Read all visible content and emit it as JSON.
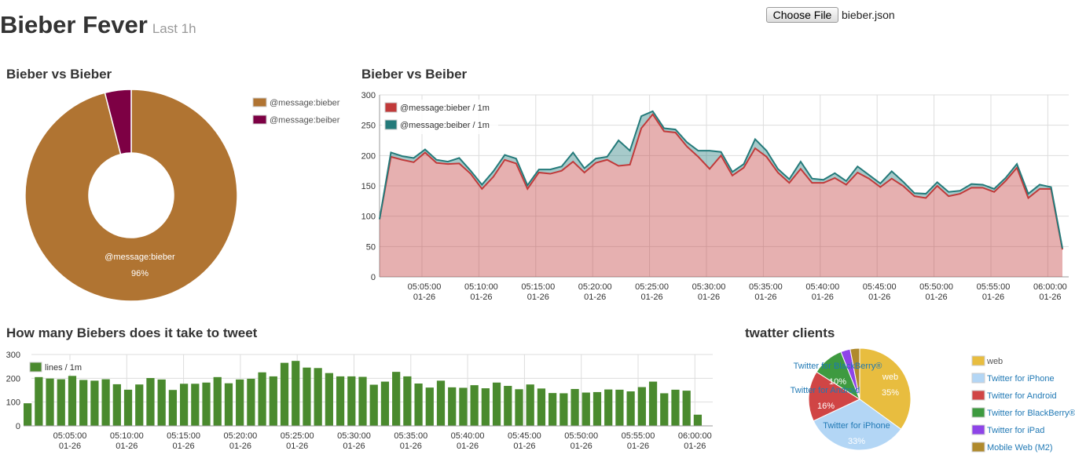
{
  "header": {
    "title": "Bieber Fever",
    "subtitle": "Last 1h"
  },
  "file_input": {
    "button_label": "Choose File",
    "file_name": "bieber.json"
  },
  "panels": {
    "donut_title": "Bieber vs Bieber",
    "area_title": "Bieber vs Beiber",
    "bar_title": "How many Biebers does it take to tweet",
    "clients_title": "twatter clients"
  },
  "x_ticks": [
    {
      "time": "05:05:00",
      "date": "01-26"
    },
    {
      "time": "05:10:00",
      "date": "01-26"
    },
    {
      "time": "05:15:00",
      "date": "01-26"
    },
    {
      "time": "05:20:00",
      "date": "01-26"
    },
    {
      "time": "05:25:00",
      "date": "01-26"
    },
    {
      "time": "05:30:00",
      "date": "01-26"
    },
    {
      "time": "05:35:00",
      "date": "01-26"
    },
    {
      "time": "05:40:00",
      "date": "01-26"
    },
    {
      "time": "05:45:00",
      "date": "01-26"
    },
    {
      "time": "05:50:00",
      "date": "01-26"
    },
    {
      "time": "05:55:00",
      "date": "01-26"
    },
    {
      "time": "06:00:00",
      "date": "01-26"
    }
  ],
  "chart_data": [
    {
      "type": "pie",
      "title": "Bieber vs Bieber",
      "labels": [
        "@message:bieber",
        "@message:beiber"
      ],
      "values": [
        96,
        4
      ],
      "colors": [
        "#b07432",
        "#7d0044"
      ],
      "slice_label": "@message:bieber",
      "slice_percent": "96%",
      "legend_position": "top-right"
    },
    {
      "type": "area",
      "title": "Bieber vs Beiber",
      "ylim": [
        0,
        300
      ],
      "yticks": [
        0,
        50,
        100,
        150,
        200,
        250,
        300
      ],
      "grid": true,
      "legend_position": "top-left",
      "series": [
        {
          "name": "@message:bieber / 1m",
          "color": "#c13a3a",
          "values": [
            95,
            198,
            193,
            189,
            205,
            188,
            186,
            187,
            170,
            145,
            165,
            193,
            187,
            145,
            172,
            170,
            175,
            190,
            172,
            188,
            193,
            183,
            185,
            245,
            268,
            240,
            238,
            215,
            198,
            178,
            200,
            167,
            180,
            212,
            198,
            172,
            155,
            178,
            155,
            155,
            163,
            152,
            172,
            162,
            148,
            162,
            150,
            133,
            130,
            150,
            133,
            137,
            147,
            147,
            140,
            158,
            180,
            130,
            145,
            145,
            45
          ]
        },
        {
          "name": "@message:beiber / 1m",
          "color": "#247a7a",
          "values": [
            0,
            7,
            6,
            7,
            5,
            5,
            4,
            9,
            5,
            7,
            9,
            8,
            8,
            6,
            5,
            7,
            7,
            15,
            7,
            7,
            5,
            42,
            23,
            20,
            5,
            5,
            5,
            7,
            10,
            30,
            6,
            6,
            6,
            15,
            10,
            6,
            6,
            12,
            7,
            5,
            8,
            6,
            10,
            6,
            6,
            12,
            7,
            5,
            7,
            6,
            7,
            5,
            6,
            5,
            5,
            5,
            6,
            7,
            7,
            3,
            2
          ]
        }
      ]
    },
    {
      "type": "bar",
      "title": "How many Biebers does it take to tweet",
      "ylim": [
        0,
        300
      ],
      "yticks": [
        0,
        100,
        200,
        300
      ],
      "grid": true,
      "legend_position": "top-left",
      "series": [
        {
          "name": "lines / 1m",
          "color": "#4a8a2e",
          "values": [
            95,
            205,
            199,
            196,
            210,
            193,
            190,
            196,
            175,
            152,
            174,
            201,
            195,
            151,
            177,
            177,
            182,
            205,
            179,
            195,
            198,
            225,
            208,
            265,
            273,
            245,
            243,
            222,
            208,
            208,
            206,
            173,
            186,
            227,
            208,
            178,
            161,
            190,
            162,
            160,
            171,
            158,
            182,
            168,
            154,
            174,
            157,
            138,
            137,
            155,
            140,
            142,
            153,
            152,
            145,
            163,
            186,
            137,
            152,
            148,
            47
          ]
        }
      ]
    },
    {
      "type": "pie",
      "title": "twatter clients",
      "labels": [
        "web",
        "Twitter for iPhone",
        "Twitter for Android",
        "Twitter for BlackBerry®",
        "Twitter for iPad",
        "Mobile Web (M2)"
      ],
      "values": [
        35,
        33,
        16,
        10,
        3,
        3
      ],
      "colors": [
        "#e8bd3f",
        "#b3d6f5",
        "#d04545",
        "#3e9a40",
        "#8e44e8",
        "#b08a2c"
      ],
      "slice_texts": [
        {
          "label": "web",
          "percent": "35%"
        },
        {
          "label": "Twitter for iPhone",
          "percent": "33%"
        },
        {
          "label": "Twitter for Android",
          "percent": "16%"
        },
        {
          "label": "Twitter for BlackBerry®",
          "percent": "10%"
        }
      ],
      "legend_position": "right"
    }
  ]
}
